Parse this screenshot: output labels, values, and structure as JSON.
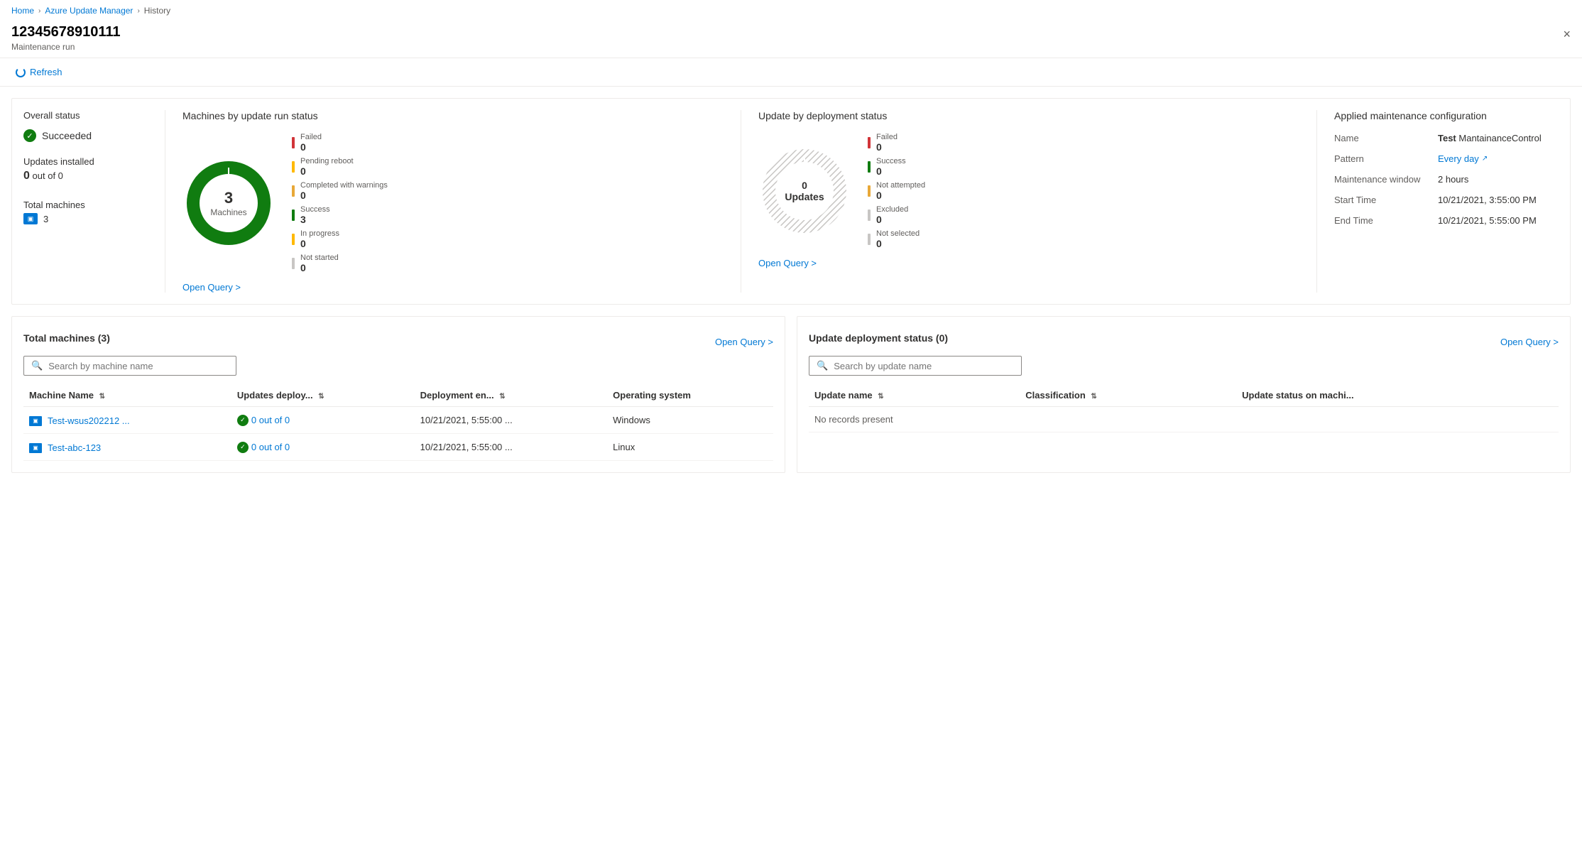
{
  "breadcrumb": {
    "home": "Home",
    "azure_update_manager": "Azure Update Manager",
    "history": "History"
  },
  "page": {
    "title": "12345678910111",
    "subtitle": "Maintenance run",
    "close_label": "×"
  },
  "toolbar": {
    "refresh_label": "Refresh"
  },
  "overall_status": {
    "section_label": "Overall status",
    "status": "Succeeded",
    "updates_installed_label": "Updates installed",
    "updates_value": "0",
    "updates_out_of": "out of 0",
    "total_machines_label": "Total machines",
    "machines_count": "3"
  },
  "machines_chart": {
    "title": "Machines by update run status",
    "center_num": "3",
    "center_text": "Machines",
    "open_query": "Open Query >",
    "legend": [
      {
        "label": "Failed",
        "value": "0",
        "color": "#d13438"
      },
      {
        "label": "Pending reboot",
        "value": "0",
        "color": "#ffb900"
      },
      {
        "label": "Completed with warnings",
        "value": "0",
        "color": "#e8a838"
      },
      {
        "label": "Success",
        "value": "3",
        "color": "#107c10"
      },
      {
        "label": "In progress",
        "value": "0",
        "color": "#ffb900"
      },
      {
        "label": "Not started",
        "value": "0",
        "color": "#c8c6c4"
      }
    ]
  },
  "updates_chart": {
    "title": "Update by deployment status",
    "center_text": "0 Updates",
    "open_query": "Open Query >",
    "legend": [
      {
        "label": "Failed",
        "value": "0",
        "color": "#d13438"
      },
      {
        "label": "Success",
        "value": "0",
        "color": "#107c10"
      },
      {
        "label": "Not attempted",
        "value": "0",
        "color": "#e8a838"
      },
      {
        "label": "Excluded",
        "value": "0",
        "color": "#c8c6c4"
      },
      {
        "label": "Not selected",
        "value": "0",
        "color": "#c8c6c4"
      }
    ]
  },
  "config": {
    "title": "Applied maintenance configuration",
    "name_label": "Name",
    "name_prefix": "Test",
    "name_value": "MantainanceControl",
    "pattern_label": "Pattern",
    "pattern_value": "Every day",
    "window_label": "Maintenance window",
    "window_value": "2 hours",
    "start_label": "Start Time",
    "start_value": "10/21/2021, 3:55:00 PM",
    "end_label": "End Time",
    "end_value": "10/21/2021, 5:55:00 PM"
  },
  "machines_table": {
    "title": "Total machines (3)",
    "open_query": "Open Query >",
    "search_placeholder": "Search by machine name",
    "columns": [
      "Machine Name",
      "Updates deploy...",
      "Deployment en...",
      "Operating system"
    ],
    "rows": [
      {
        "name": "Test-wsus202212 ...",
        "updates": "0 out of 0",
        "deployment_end": "10/21/2021, 5:55:00 ...",
        "os": "Windows"
      },
      {
        "name": "Test-abc-123",
        "updates": "0 out of 0",
        "deployment_end": "10/21/2021, 5:55:00 ...",
        "os": "Linux"
      }
    ]
  },
  "updates_table": {
    "title": "Update deployment status (0)",
    "open_query": "Open Query >",
    "search_placeholder": "Search by update name",
    "columns": [
      "Update name",
      "Classification",
      "Update status on machi..."
    ],
    "no_records": "No records present"
  }
}
